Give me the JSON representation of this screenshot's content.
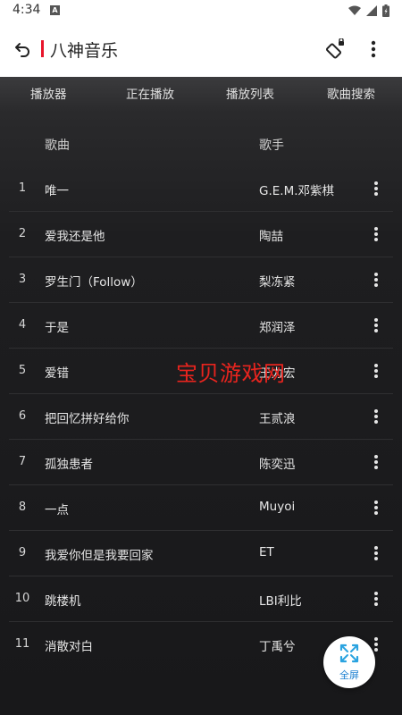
{
  "status_bar": {
    "time": "4:34",
    "notif_badge": "A",
    "icons": [
      "wifi-icon",
      "signal-icon",
      "battery-icon"
    ]
  },
  "app_bar": {
    "title": "八神音乐",
    "accent_color": "#e8142b",
    "back_icon": "back-icon",
    "rotate_icon": "screen-rotate-icon",
    "more_icon": "more-vertical-icon"
  },
  "tabs": [
    {
      "label": "播放器"
    },
    {
      "label": "正在播放"
    },
    {
      "label": "播放列表"
    },
    {
      "label": "歌曲搜索"
    }
  ],
  "list_header": {
    "song": "歌曲",
    "artist": "歌手"
  },
  "songs": [
    {
      "num": "1",
      "title": "唯一",
      "artist": "G.E.M.邓紫棋"
    },
    {
      "num": "2",
      "title": "爱我还是他",
      "artist": "陶喆"
    },
    {
      "num": "3",
      "title": "罗生门（Follow）",
      "artist": "梨冻紧"
    },
    {
      "num": "4",
      "title": "于是",
      "artist": "郑润泽"
    },
    {
      "num": "5",
      "title": "爱错",
      "artist": "王力宏"
    },
    {
      "num": "6",
      "title": "把回忆拼好给你",
      "artist": "王贰浪"
    },
    {
      "num": "7",
      "title": "孤独患者",
      "artist": "陈奕迅"
    },
    {
      "num": "8",
      "title": "一点",
      "artist": "Muyoi"
    },
    {
      "num": "9",
      "title": "我爱你但是我要回家",
      "artist": "ET"
    },
    {
      "num": "10",
      "title": "跳楼机",
      "artist": "LBI利比"
    },
    {
      "num": "11",
      "title": "消散对白",
      "artist": "丁禹兮"
    }
  ],
  "watermark": "宝贝游戏网",
  "fullscreen": {
    "label": "全屏",
    "color": "#1b7fd0"
  }
}
